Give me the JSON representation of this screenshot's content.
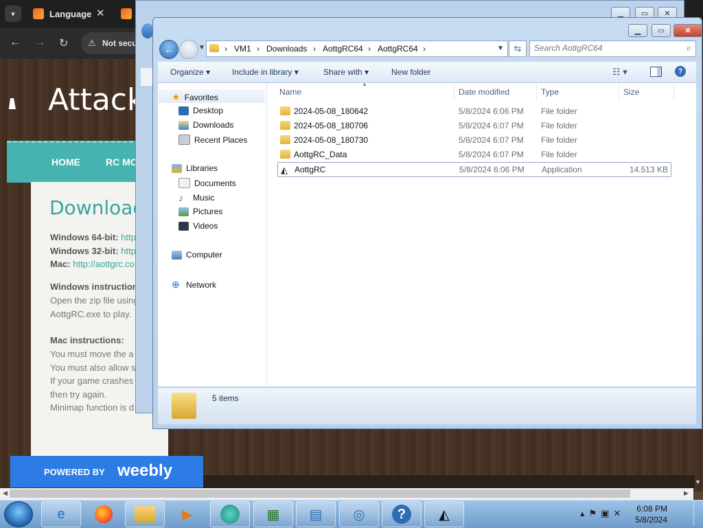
{
  "browser": {
    "tab_title": "Language",
    "security_label": "Not secu",
    "site_title": "Attack",
    "nav": [
      "HOME",
      "RC MO"
    ],
    "download_heading": "Download R",
    "lines": [
      {
        "bold": "Windows 64-bit:",
        "link": "http"
      },
      {
        "bold": "Windows 32-bit:",
        "link": "http"
      },
      {
        "bold": "Mac:",
        "link": "http://aottgrc.co"
      }
    ],
    "windows_instructions_heading": "Windows instruction",
    "windows_instructions": [
      "Open the zip file using",
      "AottgRC.exe to play."
    ],
    "mac_instructions_heading": "Mac instructions:",
    "mac_instructions": [
      "You must move the a",
      "You must also allow s",
      "If your game crashes",
      "then try again.",
      "Minimap function is d"
    ],
    "weebly_powered": "POWERED BY",
    "weebly_brand": "weebly"
  },
  "explorer": {
    "breadcrumb": [
      "VM1",
      "Downloads",
      "AottgRC64",
      "AottgRC64"
    ],
    "search_placeholder": "Search AottgRC64",
    "commands": {
      "organize": "Organize ▾",
      "include": "Include in library ▾",
      "share": "Share with ▾",
      "new_folder": "New folder"
    },
    "nav": {
      "favorites": "Favorites",
      "desktop": "Desktop",
      "downloads": "Downloads",
      "recent": "Recent Places",
      "libraries": "Libraries",
      "documents": "Documents",
      "music": "Music",
      "pictures": "Pictures",
      "videos": "Videos",
      "computer": "Computer",
      "network": "Network"
    },
    "columns": {
      "name": "Name",
      "date": "Date modified",
      "type": "Type",
      "size": "Size"
    },
    "files": [
      {
        "name": "2024-05-08_180642",
        "date": "5/8/2024 6:06 PM",
        "type": "File folder",
        "size": ""
      },
      {
        "name": "2024-05-08_180706",
        "date": "5/8/2024 6:07 PM",
        "type": "File folder",
        "size": ""
      },
      {
        "name": "2024-05-08_180730",
        "date": "5/8/2024 6:07 PM",
        "type": "File folder",
        "size": ""
      },
      {
        "name": "AottgRC_Data",
        "date": "5/8/2024 6:07 PM",
        "type": "File folder",
        "size": ""
      },
      {
        "name": "AottgRC",
        "date": "5/8/2024 6:06 PM",
        "type": "Application",
        "size": "14,513 KB"
      }
    ],
    "status": "5 items"
  },
  "taskbar": {
    "apps": [
      "ie-icon",
      "firefox-icon",
      "explorer-icon",
      "media-player-icon",
      "app-icon",
      "remote-desktop-icon",
      "control-panel-icon",
      "network-icon",
      "help-icon",
      "unity-icon"
    ],
    "time": "6:08 PM",
    "date": "5/8/2024"
  },
  "colors": {
    "accent": "#46b3b0",
    "weebly": "#2d7be5",
    "taskbar": "#86afd9"
  }
}
